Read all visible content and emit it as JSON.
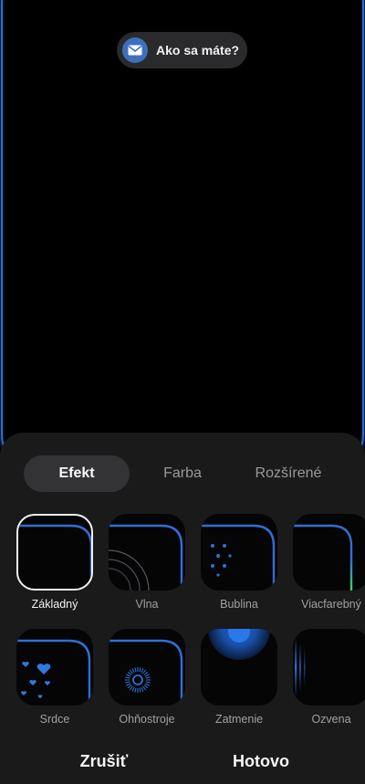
{
  "notification": {
    "text": "Ako sa máte?",
    "icon": "mail-icon"
  },
  "colors": {
    "accent_blue": "#2e6ed0",
    "sheet_bg": "#1a1a1b",
    "active_tab_bg": "#333336",
    "green_accent": "#3fd46a"
  },
  "tabs": [
    {
      "label": "Efekt",
      "active": true
    },
    {
      "label": "Farba",
      "active": false
    },
    {
      "label": "Rozšírené",
      "active": false
    }
  ],
  "effects": [
    {
      "label": "Základný",
      "selected": true
    },
    {
      "label": "Vlna",
      "selected": false
    },
    {
      "label": "Bublina",
      "selected": false
    },
    {
      "label": "Viacfarebný",
      "selected": false
    },
    {
      "label": "Srdce",
      "selected": false
    },
    {
      "label": "Ohňostroje",
      "selected": false
    },
    {
      "label": "Zatmenie",
      "selected": false
    },
    {
      "label": "Ozvena",
      "selected": false
    }
  ],
  "actions": {
    "cancel_label": "Zrušiť",
    "done_label": "Hotovo"
  }
}
